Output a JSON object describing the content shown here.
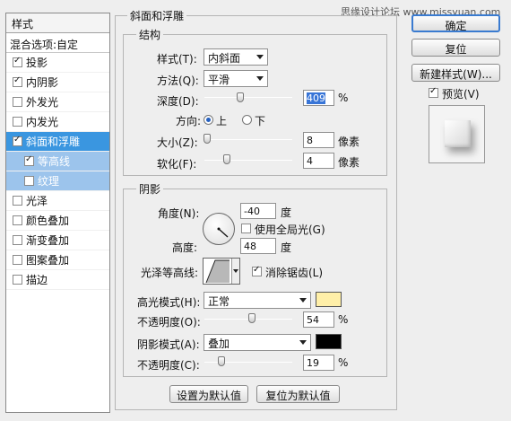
{
  "watermark": "思缘设计论坛  www.missyuan.com",
  "left_panel": {
    "header": "样式",
    "blend_options": "混合选项:自定",
    "items": [
      {
        "label": "投影",
        "checked": true
      },
      {
        "label": "内阴影",
        "checked": true
      },
      {
        "label": "外发光",
        "checked": false
      },
      {
        "label": "内发光",
        "checked": false
      },
      {
        "label": "斜面和浮雕",
        "checked": true,
        "selected": true
      },
      {
        "label": "等高线",
        "checked": true,
        "sub": true
      },
      {
        "label": "纹理",
        "checked": false,
        "sub": true
      },
      {
        "label": "光泽",
        "checked": false
      },
      {
        "label": "颜色叠加",
        "checked": false
      },
      {
        "label": "渐变叠加",
        "checked": false
      },
      {
        "label": "图案叠加",
        "checked": false
      },
      {
        "label": "描边",
        "checked": false
      }
    ]
  },
  "bevel": {
    "title": "斜面和浮雕",
    "structure_title": "结构",
    "style_label": "样式(T):",
    "style_value": "内斜面",
    "technique_label": "方法(Q):",
    "technique_value": "平滑",
    "depth_label": "深度(D):",
    "depth_value": "409",
    "depth_unit": "%",
    "depth_pct": 0.41,
    "direction_label": "方向:",
    "dir_up": "上",
    "dir_down": "下",
    "size_label": "大小(Z):",
    "size_value": "8",
    "size_unit": "像素",
    "size_pct": 0.03,
    "soften_label": "软化(F):",
    "soften_value": "4",
    "soften_unit": "像素",
    "soften_pct": 0.25
  },
  "shading": {
    "title": "阴影",
    "angle_label": "角度(N):",
    "angle_value": "-40",
    "angle_unit": "度",
    "global_light": "使用全局光(G)",
    "altitude_label": "高度:",
    "altitude_value": "48",
    "altitude_unit": "度",
    "gloss_label": "光泽等高线:",
    "antialias": "消除锯齿(L)",
    "highlight_label": "高光模式(H):",
    "highlight_value": "正常",
    "highlight_color": "#ffefa8",
    "hl_opacity_label": "不透明度(O):",
    "hl_opacity_value": "54",
    "hl_opacity_unit": "%",
    "hl_opacity_pct": 0.54,
    "shadow_label": "阴影模式(A):",
    "shadow_value": "叠加",
    "shadow_color": "#000000",
    "sh_opacity_label": "不透明度(C):",
    "sh_opacity_value": "19",
    "sh_opacity_unit": "%",
    "sh_opacity_pct": 0.19
  },
  "buttons": {
    "ok": "确定",
    "reset": "复位",
    "new_style": "新建样式(W)...",
    "preview": "预览(V)",
    "make_default": "设置为默认值",
    "reset_default": "复位为默认值"
  }
}
